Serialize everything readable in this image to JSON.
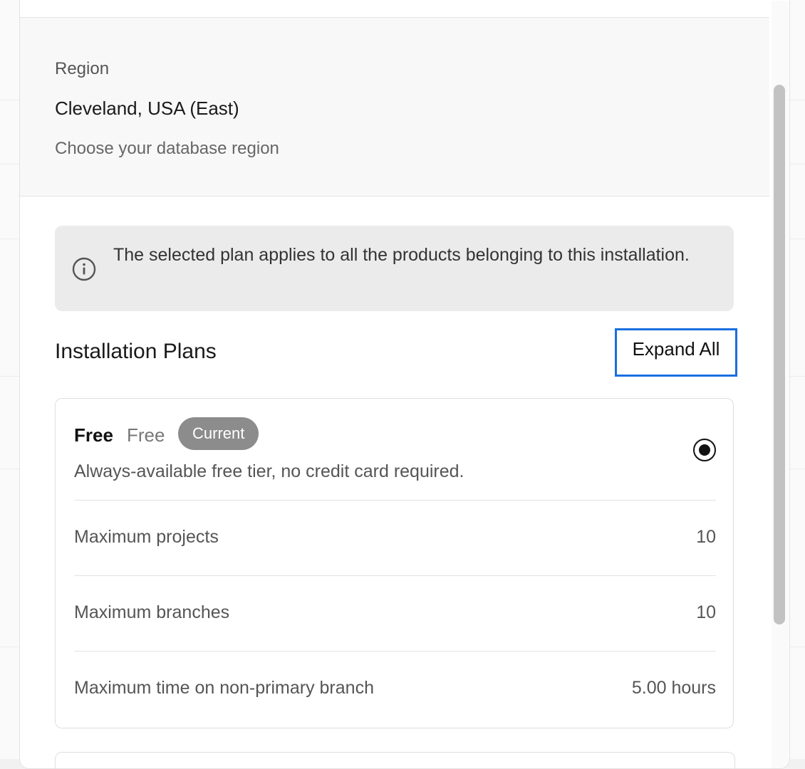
{
  "region": {
    "label": "Region",
    "value": "Cleveland, USA (East)",
    "help": "Choose your database region"
  },
  "notice": {
    "icon": "info-icon",
    "text": "The selected plan applies to all the products belonging to this installation."
  },
  "plans": {
    "title": "Installation Plans",
    "expand_label": "Expand All",
    "items": [
      {
        "name": "Free",
        "price": "Free",
        "badge": "Current",
        "description": "Always-available free tier, no credit card required.",
        "selected": true,
        "rows": [
          {
            "label": "Maximum projects",
            "value": "10"
          },
          {
            "label": "Maximum branches",
            "value": "10"
          },
          {
            "label": "Maximum time on non-primary branch",
            "value": "5.00 hours"
          }
        ]
      }
    ]
  }
}
